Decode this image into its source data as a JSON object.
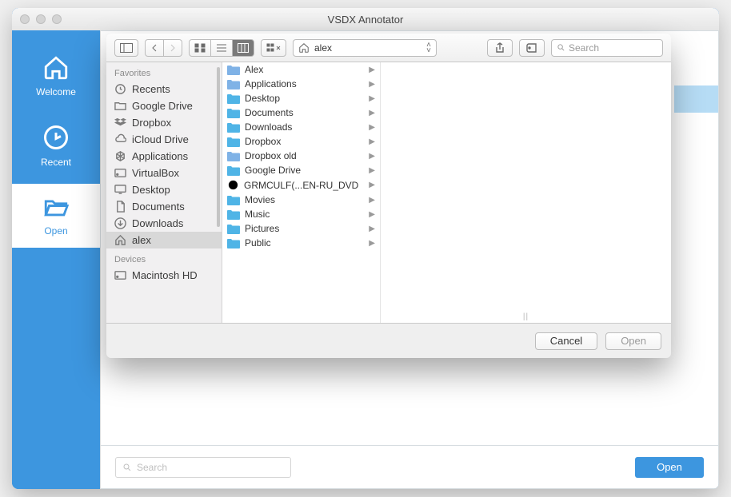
{
  "app": {
    "title": "VSDX Annotator",
    "sidebar": [
      {
        "id": "welcome",
        "label": "Welcome",
        "icon": "house-icon"
      },
      {
        "id": "recent",
        "label": "Recent",
        "icon": "clock-icon"
      },
      {
        "id": "open",
        "label": "Open",
        "icon": "folder-open-icon",
        "active": true
      }
    ],
    "bottom_search_placeholder": "Search",
    "bottom_open_label": "Open"
  },
  "dialog": {
    "path_label": "alex",
    "search_placeholder": "Search",
    "cancel_label": "Cancel",
    "open_label": "Open",
    "sidebar_sections": [
      {
        "title": "Favorites",
        "items": [
          {
            "label": "Recents",
            "icon": "clock"
          },
          {
            "label": "Google Drive",
            "icon": "folder"
          },
          {
            "label": "Dropbox",
            "icon": "dropbox"
          },
          {
            "label": "iCloud Drive",
            "icon": "cloud"
          },
          {
            "label": "Applications",
            "icon": "app"
          },
          {
            "label": "VirtualBox",
            "icon": "drive"
          },
          {
            "label": "Desktop",
            "icon": "desktop"
          },
          {
            "label": "Documents",
            "icon": "doc"
          },
          {
            "label": "Downloads",
            "icon": "download"
          },
          {
            "label": "alex",
            "icon": "house",
            "selected": true
          }
        ]
      },
      {
        "title": "Devices",
        "items": [
          {
            "label": "Macintosh HD",
            "icon": "drive"
          }
        ]
      }
    ],
    "column_items": [
      {
        "label": "Alex",
        "icon": "folder"
      },
      {
        "label": "Applications",
        "icon": "folder"
      },
      {
        "label": "Desktop",
        "icon": "folder-sys"
      },
      {
        "label": "Documents",
        "icon": "folder-sys"
      },
      {
        "label": "Downloads",
        "icon": "folder-sys"
      },
      {
        "label": "Dropbox",
        "icon": "folder-sys"
      },
      {
        "label": "Dropbox old",
        "icon": "folder"
      },
      {
        "label": "Google Drive",
        "icon": "folder-sys"
      },
      {
        "label": "GRMCULF(...EN-RU_DVD",
        "icon": "disc"
      },
      {
        "label": "Movies",
        "icon": "folder-sys"
      },
      {
        "label": "Music",
        "icon": "folder-sys"
      },
      {
        "label": "Pictures",
        "icon": "folder-sys"
      },
      {
        "label": "Public",
        "icon": "folder-sys"
      }
    ]
  }
}
